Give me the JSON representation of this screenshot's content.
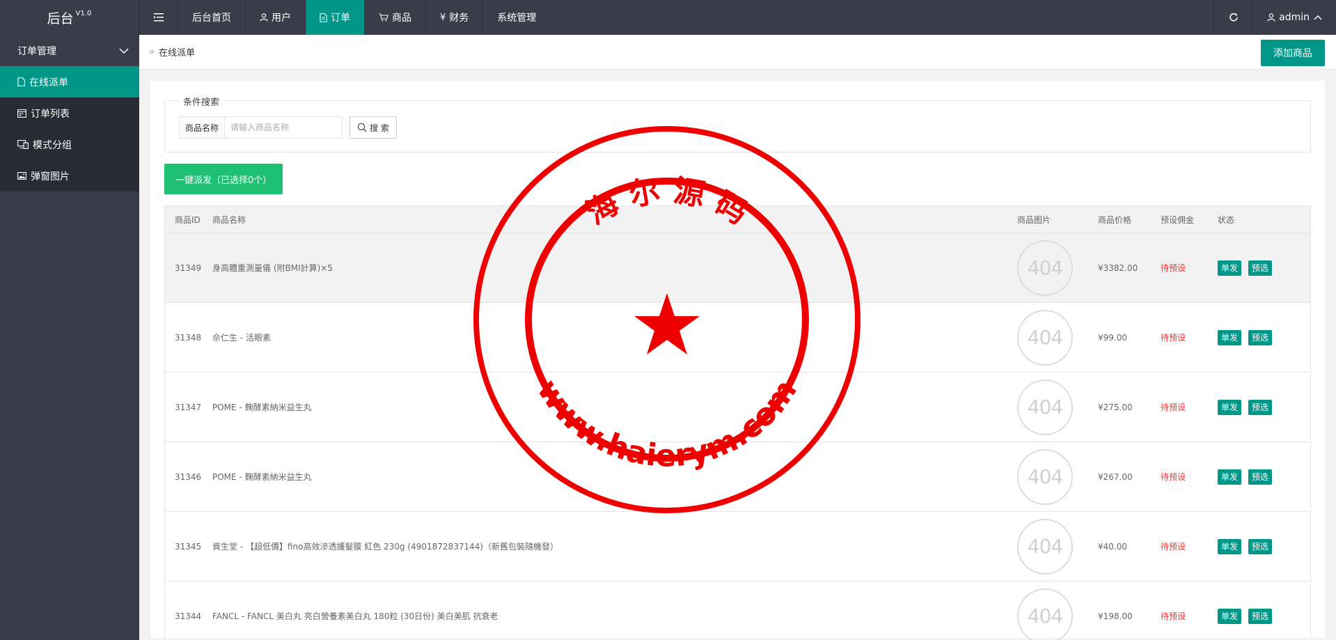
{
  "header": {
    "logo": "后台",
    "version": "V1.0",
    "nav": [
      {
        "label": "后台首页",
        "icon": ""
      },
      {
        "label": "用户",
        "icon": "user-icon"
      },
      {
        "label": "订单",
        "icon": "document-icon",
        "active": true
      },
      {
        "label": "商品",
        "icon": "cart-icon"
      },
      {
        "label": "财务",
        "icon": "yen-icon"
      },
      {
        "label": "系统管理",
        "icon": ""
      }
    ],
    "user": "admin"
  },
  "sidebar": {
    "group": "订单管理",
    "items": [
      {
        "label": "在线派单",
        "icon": "document-icon",
        "active": true
      },
      {
        "label": "订单列表",
        "icon": "calendar-icon"
      },
      {
        "label": "模式分组",
        "icon": "monitor-icon"
      },
      {
        "label": "弹窗图片",
        "icon": "image-icon"
      }
    ]
  },
  "breadcrumb": "在线派单",
  "add_button": "添加商品",
  "search": {
    "legend": "条件搜索",
    "label": "商品名称",
    "placeholder": "请输入商品名称",
    "button": "搜 索"
  },
  "dispatch_button": "一键派发（已选择0个）",
  "table": {
    "headers": {
      "id": "商品ID",
      "name": "商品名称",
      "image": "商品图片",
      "price": "商品价格",
      "commission": "预设佣金",
      "status": "状态"
    },
    "image_placeholder": "404",
    "btn_single": "单发",
    "btn_preselect": "预选",
    "rows": [
      {
        "id": "31349",
        "name": "身高體重測量儀 (附BMI計算)×5",
        "price": "¥3382.00",
        "commission": "待预设"
      },
      {
        "id": "31348",
        "name": "佘仁生 - 活眼素",
        "price": "¥99.00",
        "commission": "待预设"
      },
      {
        "id": "31347",
        "name": "POME - 麴酵素納米益生丸",
        "price": "¥275.00",
        "commission": "待预设"
      },
      {
        "id": "31346",
        "name": "POME - 麴酵素納米益生丸",
        "price": "¥267.00",
        "commission": "待预设"
      },
      {
        "id": "31345",
        "name": "資生堂 - 【超低價】fino高效滲透護髮膜 紅色 230g (4901872837144)（新舊包裝隨機發）",
        "price": "¥40.00",
        "commission": "待预设"
      },
      {
        "id": "31344",
        "name": "FANCL - FANCL 美白丸 亮白營養素美白丸 180粒 (30日份) 美白美肌 抗衰老",
        "price": "¥198.00",
        "commission": "待预设"
      }
    ]
  },
  "stamp": {
    "top_text": "海 尔 源 码",
    "bottom_text": "www.haierym.com",
    "color": "#ee0000"
  }
}
